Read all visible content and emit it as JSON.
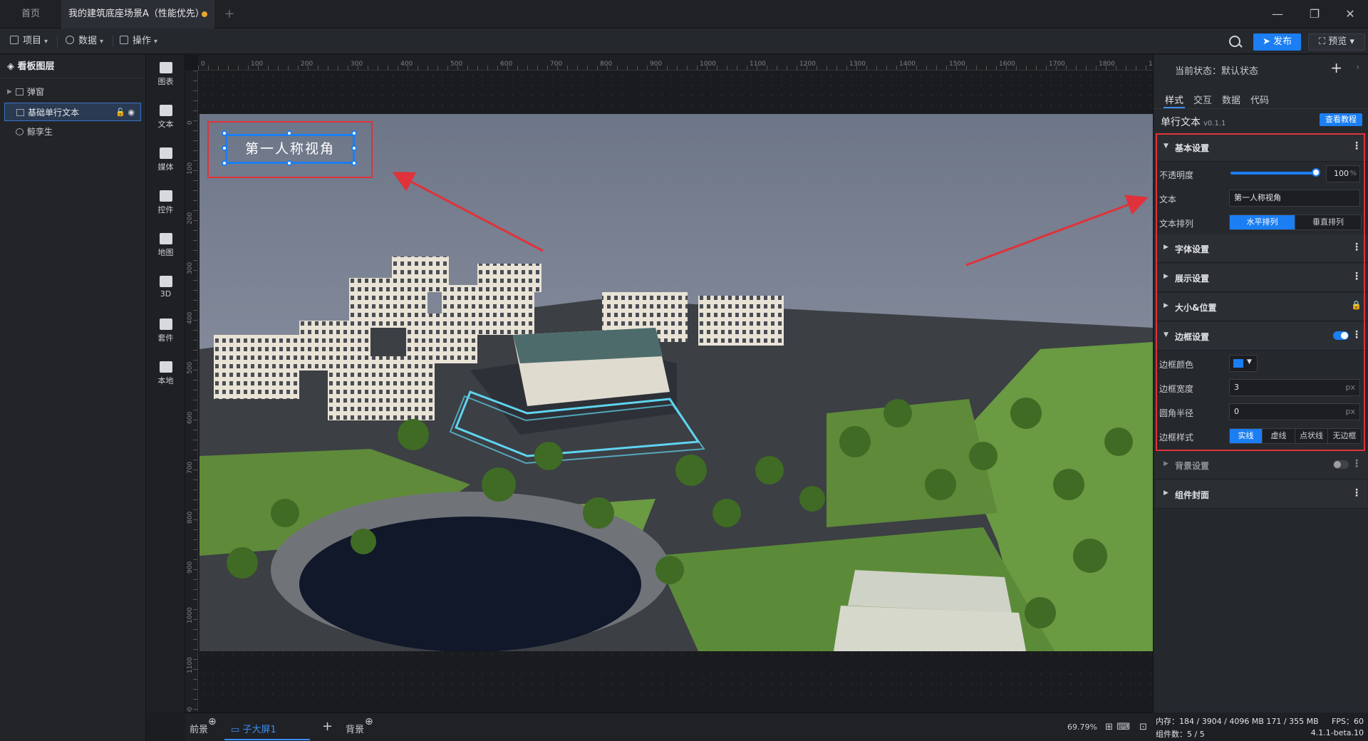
{
  "tabs": {
    "home": "首页",
    "active": "我的建筑底座场景A（性能优先）",
    "add": "+"
  },
  "window": {
    "minimize": "—",
    "restore": "❐",
    "close": "✕"
  },
  "toolbar": {
    "project": "项目",
    "data": "数据",
    "operate": "操作",
    "publish": "发布",
    "preview": "预览"
  },
  "layers": {
    "title": "看板图层",
    "items": [
      {
        "label": "弹窗"
      },
      {
        "label": "基础单行文本"
      },
      {
        "label": "鲸孪生"
      }
    ]
  },
  "components": [
    "图表",
    "文本",
    "媒体",
    "控件",
    "地图",
    "3D",
    "套件",
    "本地"
  ],
  "ruler": {
    "h": [
      "0",
      "100",
      "200",
      "300",
      "400",
      "500",
      "600",
      "700",
      "800",
      "900",
      "1000",
      "1100",
      "1200",
      "1300",
      "1400",
      "1500",
      "1600",
      "1700",
      "1800",
      "1900"
    ],
    "v": [
      "0",
      "100",
      "200",
      "300",
      "400",
      "500",
      "600",
      "700",
      "800",
      "900",
      "1000",
      "1100",
      "1200"
    ]
  },
  "canvas": {
    "text_value": "第一人称视角"
  },
  "bottombar": {
    "front": "前景",
    "child": "子大屏1",
    "back": "背景",
    "add": "+",
    "zoom": "69.79%"
  },
  "props": {
    "state_label": "当前状态：",
    "state_value": "默认状态",
    "plus": "+",
    "arrow": "›",
    "tabs": [
      "样式",
      "交互",
      "数据",
      "代码"
    ],
    "component_name": "单行文本",
    "component_version": "v0.1.1",
    "tutorial": "查看教程",
    "sections": {
      "basic": "基本设置",
      "font": "字体设置",
      "display": "展示设置",
      "size_pos": "大小&位置",
      "border": "边框设置",
      "background": "背景设置",
      "cover": "组件封面"
    },
    "opacity": {
      "label": "不透明度",
      "value": "100",
      "unit": "%",
      "level": 1.0
    },
    "text": {
      "label": "文本",
      "value": "第一人称视角"
    },
    "text_arrange": {
      "label": "文本排列",
      "options": [
        "水平排列",
        "垂直排列"
      ],
      "selected": 0
    },
    "border_color": {
      "label": "边框颜色",
      "color": "#1b7ef2"
    },
    "border_width": {
      "label": "边框宽度",
      "value": "3",
      "unit": "px"
    },
    "radius": {
      "label": "圆角半径",
      "value": "0",
      "unit": "px"
    },
    "border_style": {
      "label": "边框样式",
      "options": [
        "实线",
        "虚线",
        "点状线",
        "无边框"
      ],
      "selected": 0
    }
  },
  "status": {
    "memory_label": "内存：",
    "memory_value": "184 / 3904 / 4096 MB",
    "memory_value2": "171 / 355 MB",
    "fps_label": "FPS：",
    "fps_value": "60",
    "count_label": "组件数：",
    "count_value": "5 / 5",
    "version": "4.1.1-beta.10"
  },
  "colors": {
    "accent": "#1b7ef2",
    "annotation": "#e0323a"
  }
}
